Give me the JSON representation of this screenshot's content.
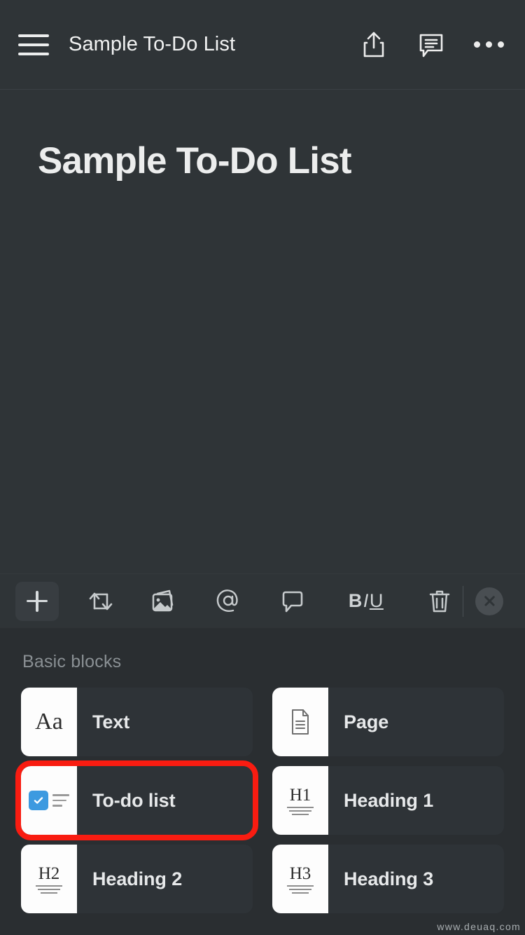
{
  "colors": {
    "app_background": "#2f3437",
    "panel_background": "#2a2e31",
    "card_background": "#2e3337",
    "highlight_accent": "#f91c11",
    "checkbox_blue": "#3d9ae0",
    "text_primary": "#e9eaea",
    "text_muted": "#8a9094"
  },
  "appbar": {
    "menu_icon": "hamburger-menu-icon",
    "title": "Sample To-Do List",
    "actions": [
      {
        "name": "share-icon",
        "label": "Share"
      },
      {
        "name": "comment-icon",
        "label": "Comments"
      },
      {
        "name": "more-options-icon",
        "label": "More"
      }
    ]
  },
  "document": {
    "title": "Sample To-Do List",
    "body": ""
  },
  "toolbar": {
    "items": [
      {
        "name": "add-block-button",
        "icon": "plus-icon",
        "label": "Add block",
        "active": true
      },
      {
        "name": "turn-into-button",
        "icon": "turn-into-arrows-icon",
        "label": "Turn into"
      },
      {
        "name": "insert-image-button",
        "icon": "image-icon",
        "label": "Image"
      },
      {
        "name": "mention-button",
        "icon": "at-mention-icon",
        "label": "Mention"
      },
      {
        "name": "comment-button",
        "icon": "comment-bubble-icon",
        "label": "Comment"
      },
      {
        "name": "text-format-button",
        "icon": "biu-format-icon",
        "label": "BIU",
        "parts": {
          "bold": "B",
          "italic": "I",
          "underline": "U"
        }
      },
      {
        "name": "delete-button",
        "icon": "trash-icon",
        "label": "Delete"
      },
      {
        "name": "close-toolbar-button",
        "icon": "close-icon",
        "label": "Close"
      }
    ]
  },
  "blocks_panel": {
    "section_label": "Basic blocks",
    "items": [
      {
        "name": "block-text",
        "label": "Text",
        "thumb": "aa-serif-glyph",
        "highlighted": false
      },
      {
        "name": "block-page",
        "label": "Page",
        "thumb": "document-page-icon",
        "highlighted": false
      },
      {
        "name": "block-todo-list",
        "label": "To-do list",
        "thumb": "checkbox-lines-icon",
        "highlighted": true
      },
      {
        "name": "block-heading-1",
        "label": "Heading 1",
        "thumb": "h1-glyph",
        "highlighted": false
      },
      {
        "name": "block-heading-2",
        "label": "Heading 2",
        "thumb": "h2-glyph",
        "highlighted": false
      },
      {
        "name": "block-heading-3",
        "label": "Heading 3",
        "thumb": "h3-glyph",
        "highlighted": false
      }
    ],
    "thumb_glyph_text": {
      "text": "Aa",
      "heading_1": "H1",
      "heading_2": "H2",
      "heading_3": "H3"
    }
  },
  "watermark": {
    "text": "www.deuaq.com"
  }
}
